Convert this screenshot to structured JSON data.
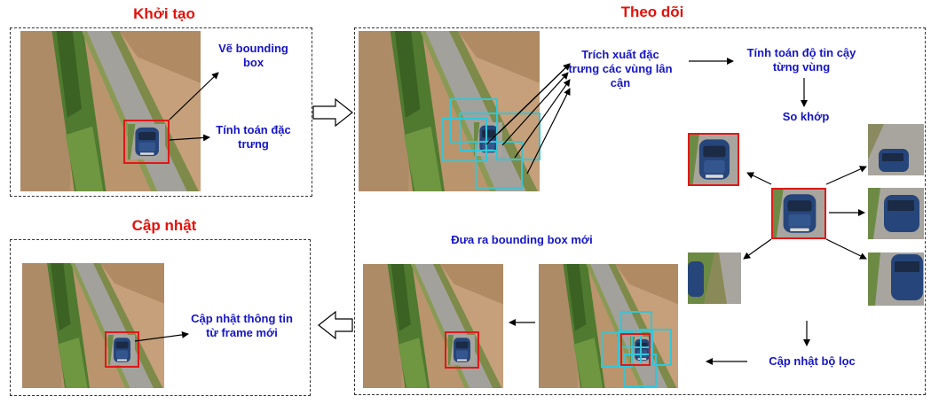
{
  "colors": {
    "title": "#e3120b",
    "label": "#1515c8",
    "box_red": "#e01818",
    "box_cyan": "#33c6d8",
    "field_left": "#b4916c",
    "field_right": "#c49a6c",
    "road": "#a6a39c",
    "grass": "#5f8a3a",
    "car": "#26457a"
  },
  "init": {
    "title": "Khởi tạo",
    "draw_bbox": "Vẽ bounding box",
    "compute_features": "Tính toán đặc trưng"
  },
  "tracking": {
    "title": "Theo dõi",
    "extract_features": "Trích xuất đặc trưng các vùng lân cận",
    "compute_confidence": "Tính toán độ tin cậy từng vùng",
    "matching": "So khớp",
    "update_filter": "Cập nhật bộ lọc",
    "output_bbox": "Đưa ra bounding box mới"
  },
  "update": {
    "title": "Cập nhật",
    "update_info": "Cập nhật thông tin từ frame mới"
  }
}
